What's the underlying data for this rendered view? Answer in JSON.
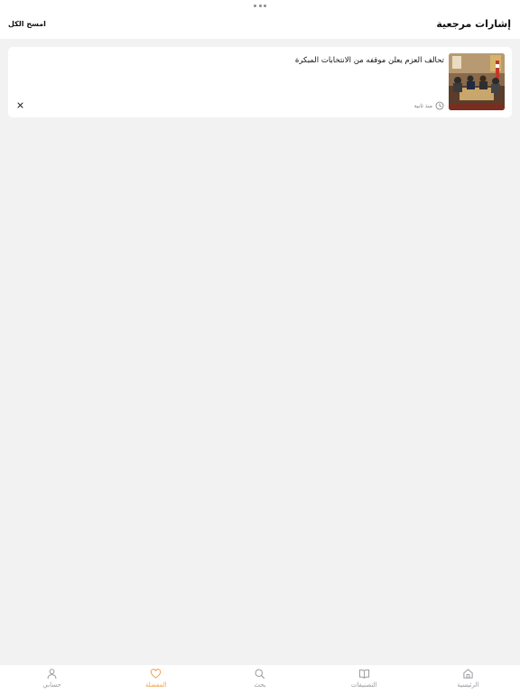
{
  "header": {
    "title": "إشارات مرجعية",
    "clear_all_label": "امسح الكل"
  },
  "bookmarks": [
    {
      "headline": "تحالف العزم يعلن موقفه من الانتخابات المبكرة",
      "time": "منذ ثانية",
      "thumbnail_icon": "meeting-photo"
    }
  ],
  "tabbar": {
    "items": [
      {
        "label": "الرئيسية",
        "icon": "home-icon",
        "active": false
      },
      {
        "label": "التصنيفات",
        "icon": "book-icon",
        "active": false
      },
      {
        "label": "بحث",
        "icon": "search-icon",
        "active": false
      },
      {
        "label": "المفضلة",
        "icon": "heart-icon",
        "active": true
      },
      {
        "label": "حسابي",
        "icon": "user-icon",
        "active": false
      }
    ]
  },
  "colors": {
    "accent": "#f0a04b",
    "inactive": "#9b9ba0",
    "background": "#f2f2f3",
    "surface": "#ffffff"
  }
}
